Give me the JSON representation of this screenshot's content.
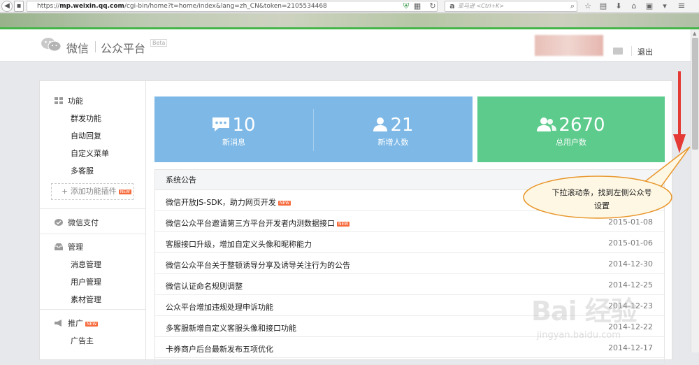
{
  "browser": {
    "url_host": "mp.weixin.qq.com",
    "url_prefix": "https://",
    "url_path": "/cgi-bin/home?t=home/index&lang=zh_CN&token=2105534468",
    "search_placeholder": "亚马逊 <Ctrl+K>"
  },
  "header": {
    "logo_text": "微信",
    "platform_text": "公众平台",
    "beta_label": "Beta",
    "logout_label": "退出"
  },
  "sidebar": {
    "function_group": "功能",
    "function_items": [
      "群发功能",
      "自动回复",
      "自定义菜单",
      "多客服"
    ],
    "add_plugin_label": "+ 添加功能插件",
    "new_badge": "NEW",
    "payment_group": "微信支付",
    "manage_group": "管理",
    "manage_items": [
      "消息管理",
      "用户管理",
      "素材管理"
    ],
    "promo_group": "推广",
    "promo_items": [
      "广告主"
    ]
  },
  "stats": [
    {
      "value": "10",
      "label": "新消息",
      "icon": "message-icon"
    },
    {
      "value": "21",
      "label": "新增人数",
      "icon": "user-icon"
    },
    {
      "value": "2670",
      "label": "总用户数",
      "icon": "users-icon"
    }
  ],
  "announcements": {
    "title": "系统公告",
    "rows": [
      {
        "title": "微信开放JS-SDK，助力网页开发",
        "date": "",
        "is_new": true
      },
      {
        "title": "微信公众平台邀请第三方平台开发者内测数据接口",
        "date": "2015-01-08",
        "is_new": true
      },
      {
        "title": "客服接口升级，增加自定义头像和昵称能力",
        "date": "2015-01-06",
        "is_new": false
      },
      {
        "title": "微信公众平台关于整顿诱导分享及诱导关注行为的公告",
        "date": "2014-12-30",
        "is_new": false
      },
      {
        "title": "微信认证命名规则调整",
        "date": "2014-12-25",
        "is_new": false
      },
      {
        "title": "公众平台增加违规处理申诉功能",
        "date": "2014-12-23",
        "is_new": false
      },
      {
        "title": "多客服新增自定义客服头像和接口功能",
        "date": "2014-12-22",
        "is_new": false
      },
      {
        "title": "卡券商户后台最新发布五项优化",
        "date": "2014-12-17",
        "is_new": false
      }
    ]
  },
  "callout": {
    "text": "下拉滚动条，找到左侧公众号设置"
  },
  "watermark": {
    "brand": "Bai 经验",
    "domain": "jingyan.baidu.com"
  },
  "colors": {
    "accent_green": "#44b549",
    "stat_blue": "#7db8e6",
    "stat_green": "#5ccb8c",
    "arrow_red": "#e53935",
    "callout_fill": "#fef7e4",
    "callout_border": "#e8962a"
  }
}
